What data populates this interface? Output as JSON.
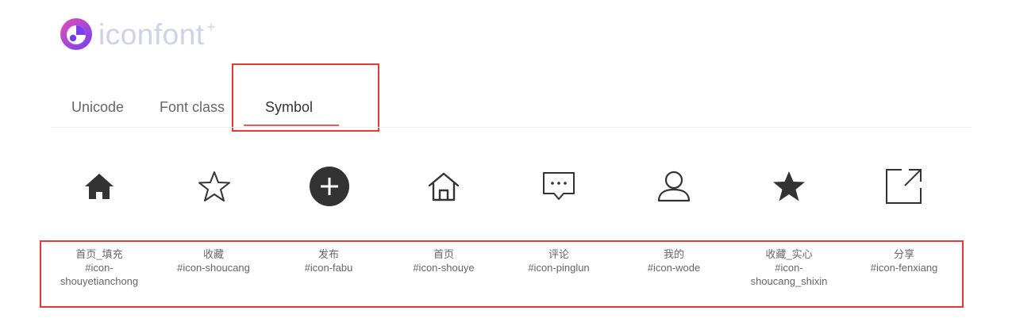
{
  "logo": {
    "text": "iconfont",
    "plus": "+",
    "mark_colors": [
      "#7b3ff2",
      "#e64fb5",
      "#ffffff"
    ]
  },
  "tabs": [
    {
      "label": "Unicode",
      "active": false
    },
    {
      "label": "Font class",
      "active": false
    },
    {
      "label": "Symbol",
      "active": true
    }
  ],
  "icons": [
    {
      "icon": "home-filled-icon",
      "name": "首页_填充",
      "class_line1": "#icon-",
      "class_line2": "shouyetianchong"
    },
    {
      "icon": "star-outline-icon",
      "name": "收藏",
      "class_line1": "#icon-shoucang",
      "class_line2": ""
    },
    {
      "icon": "plus-circle-filled-icon",
      "name": "发布",
      "class_line1": "#icon-fabu",
      "class_line2": ""
    },
    {
      "icon": "home-outline-icon",
      "name": "首页",
      "class_line1": "#icon-shouye",
      "class_line2": ""
    },
    {
      "icon": "comment-icon",
      "name": "评论",
      "class_line1": "#icon-pinglun",
      "class_line2": ""
    },
    {
      "icon": "user-icon",
      "name": "我的",
      "class_line1": "#icon-wode",
      "class_line2": ""
    },
    {
      "icon": "star-filled-icon",
      "name": "收藏_实心",
      "class_line1": "#icon-",
      "class_line2": "shoucang_shixin"
    },
    {
      "icon": "share-icon",
      "name": "分享",
      "class_line1": "#icon-fenxiang",
      "class_line2": ""
    }
  ],
  "colors": {
    "icon": "#333333",
    "tab_underline": "#e15d5d",
    "highlight_border": "#e53935",
    "label_text": "#666666"
  }
}
